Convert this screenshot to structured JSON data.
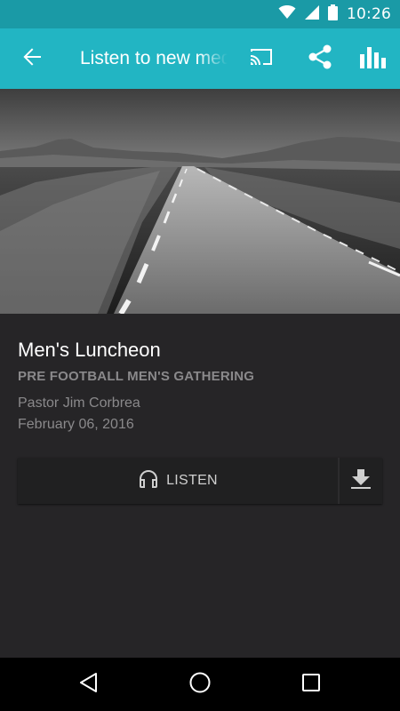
{
  "status_bar": {
    "time": "10:26",
    "icons": [
      "wifi-icon",
      "cellular-signal-icon",
      "battery-icon"
    ]
  },
  "app_bar": {
    "title": "Listen to new media",
    "actions": [
      "cast-icon",
      "share-icon",
      "bar-chart-icon"
    ],
    "color": "#22b5c3"
  },
  "sermon": {
    "title": "Men's Luncheon",
    "series": "PRE FOOTBALL MEN'S GATHERING",
    "speaker": "Pastor Jim Corbrea",
    "date": "February 06, 2016"
  },
  "actions": {
    "listen_label": "LISTEN",
    "listen_icon": "headphones-icon",
    "download_icon": "download-icon"
  },
  "nav_bar": {
    "buttons": [
      "nav-back-icon",
      "nav-home-icon",
      "nav-recents-icon"
    ]
  }
}
